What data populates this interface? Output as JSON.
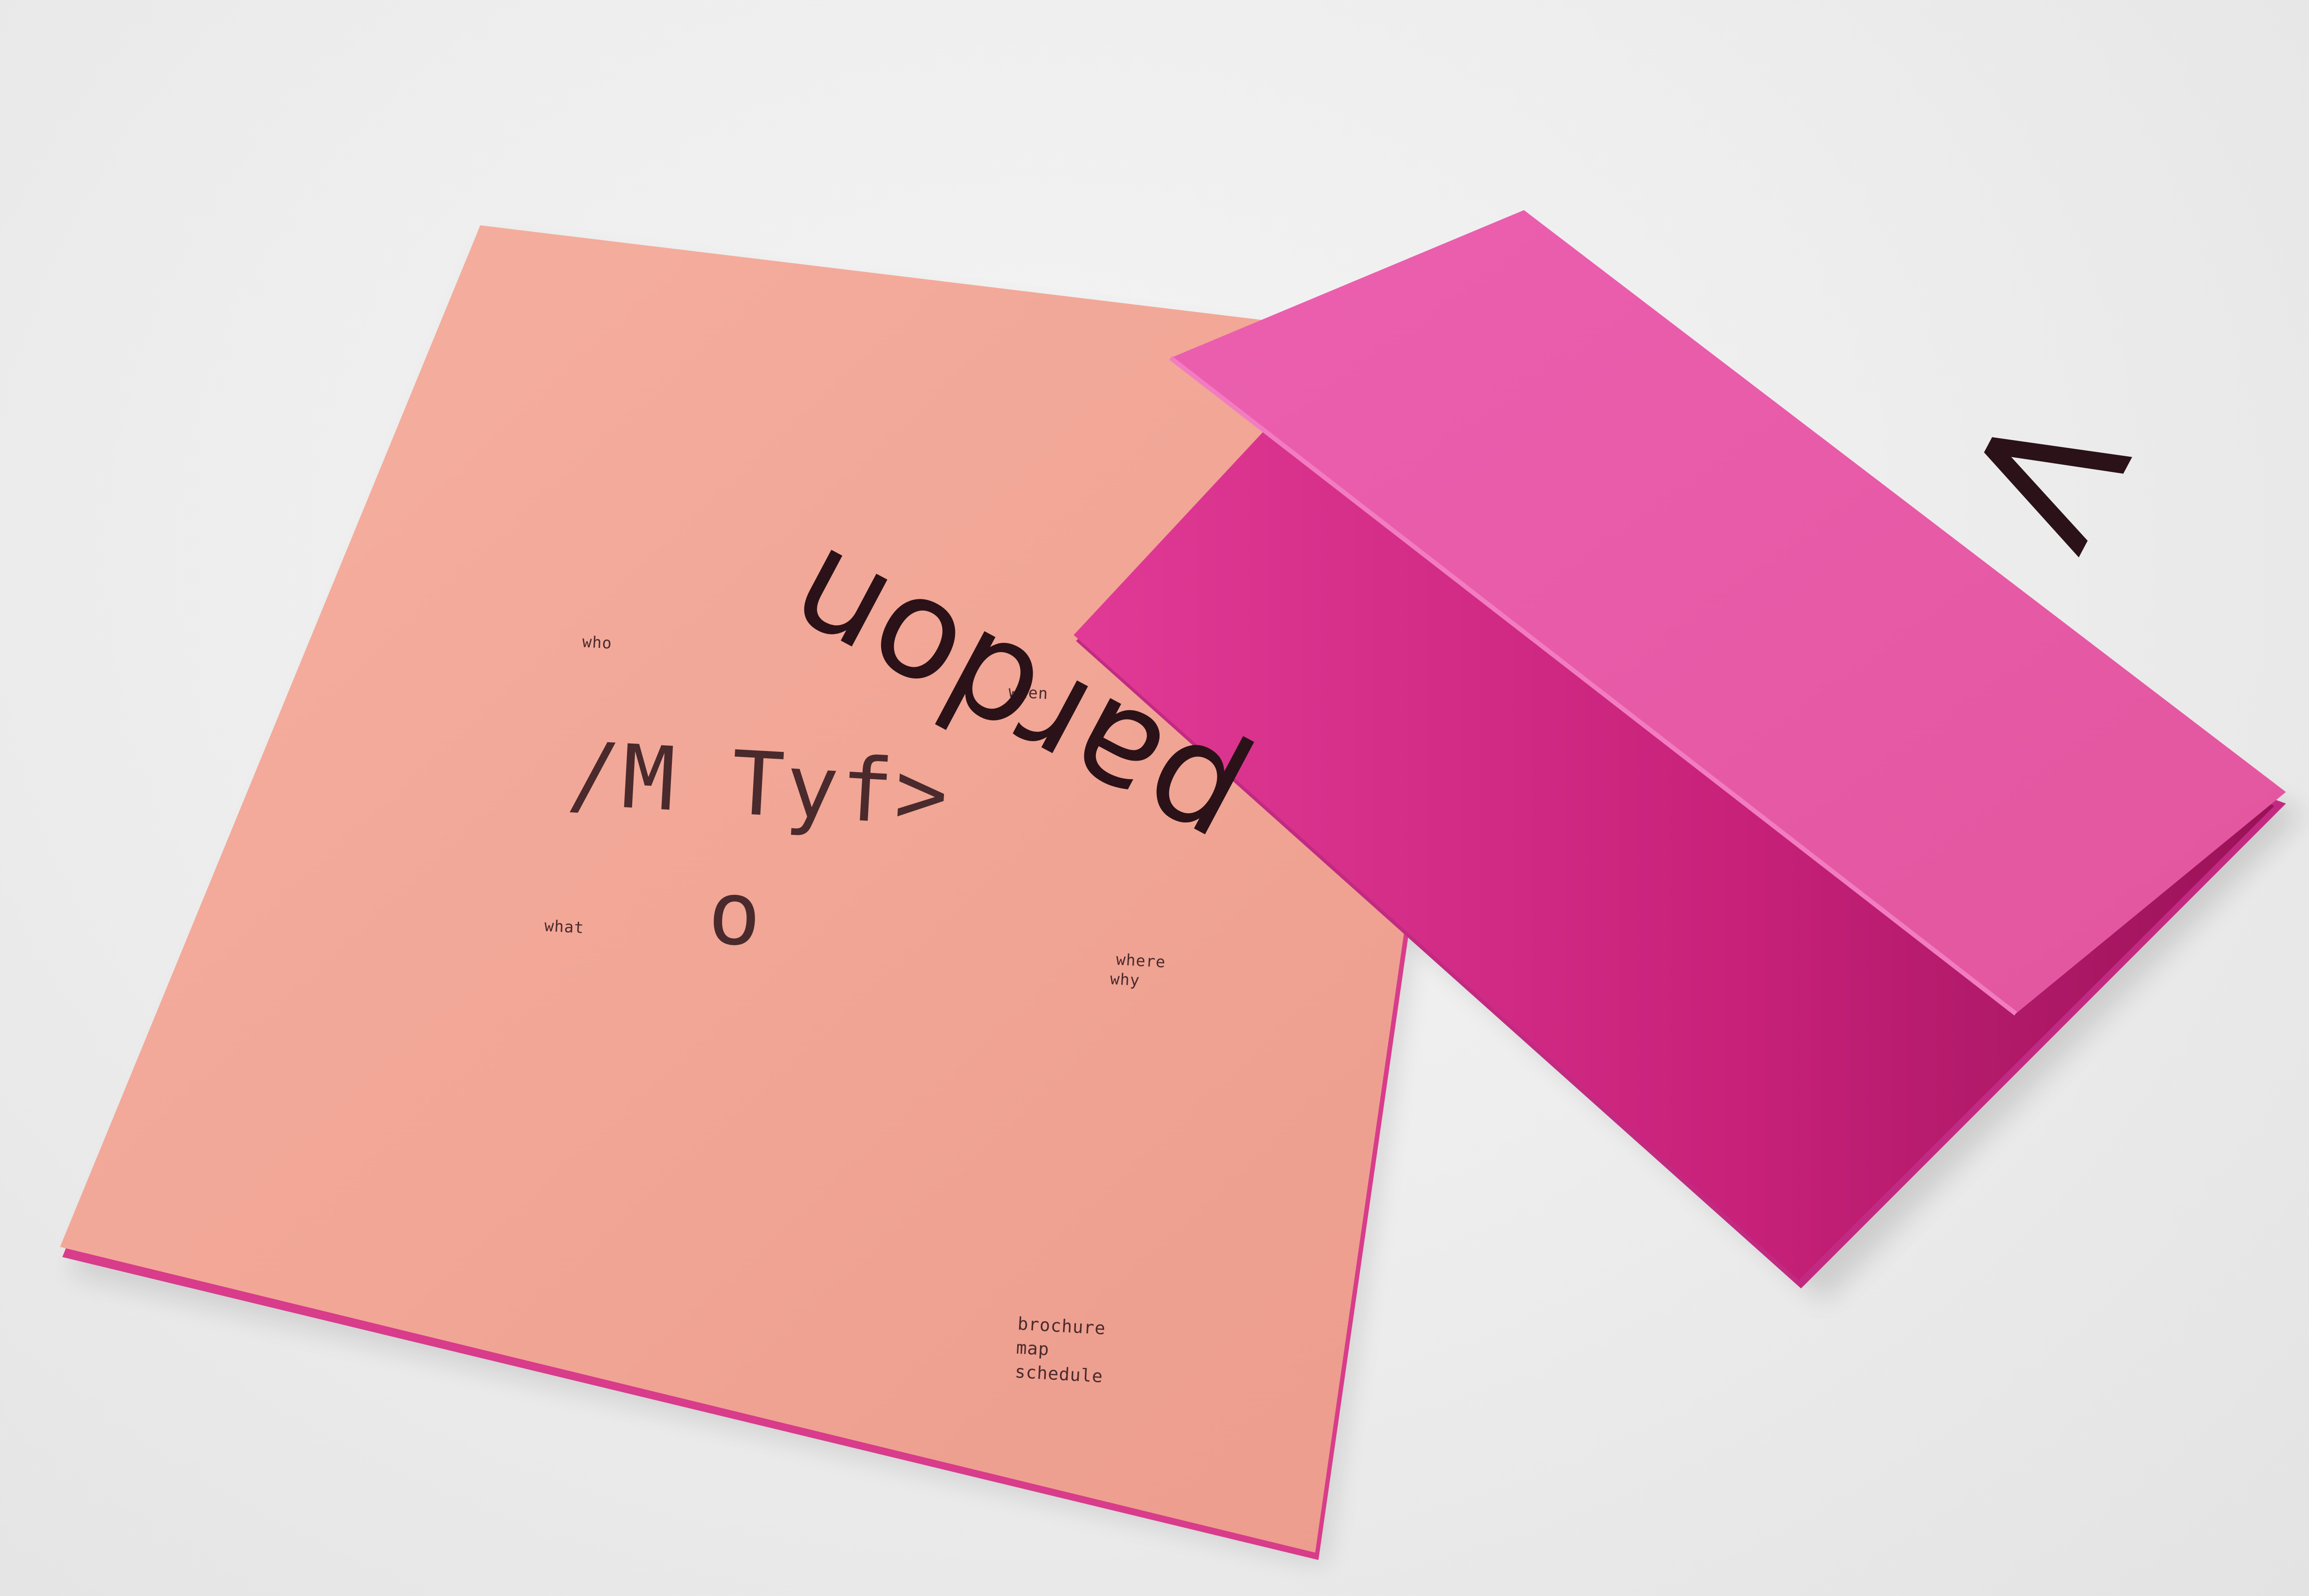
{
  "brochure": {
    "color": "#f2a596",
    "labels": {
      "who": "who",
      "when": "when",
      "what": "what",
      "where": "where",
      "why": "why"
    },
    "title_line1": "/M Tyf>",
    "title_line2": "o",
    "nav": [
      "brochure",
      "map",
      "schedule"
    ]
  },
  "flyer": {
    "color": "#e95aa5",
    "word": "pardon",
    "chevron": ">"
  }
}
